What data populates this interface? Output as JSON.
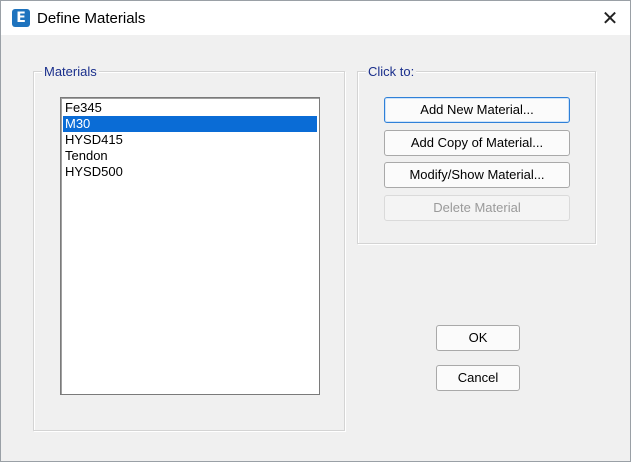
{
  "window": {
    "title": "Define Materials",
    "app_icon_letter": "E",
    "close_glyph": "✕"
  },
  "materials_group": {
    "label": "Materials",
    "items": [
      {
        "label": "Fe345",
        "selected": false
      },
      {
        "label": "M30",
        "selected": true
      },
      {
        "label": "HYSD415",
        "selected": false
      },
      {
        "label": "Tendon",
        "selected": false
      },
      {
        "label": "HYSD500",
        "selected": false
      }
    ]
  },
  "actions_group": {
    "label": "Click to:",
    "add_new": "Add New Material...",
    "add_copy": "Add Copy of Material...",
    "modify_show": "Modify/Show Material...",
    "delete": "Delete Material"
  },
  "buttons": {
    "ok": "OK",
    "cancel": "Cancel"
  },
  "colors": {
    "selection": "#0a6cd6",
    "group_label": "#1a2f8c",
    "app_icon": "#1e73be"
  }
}
